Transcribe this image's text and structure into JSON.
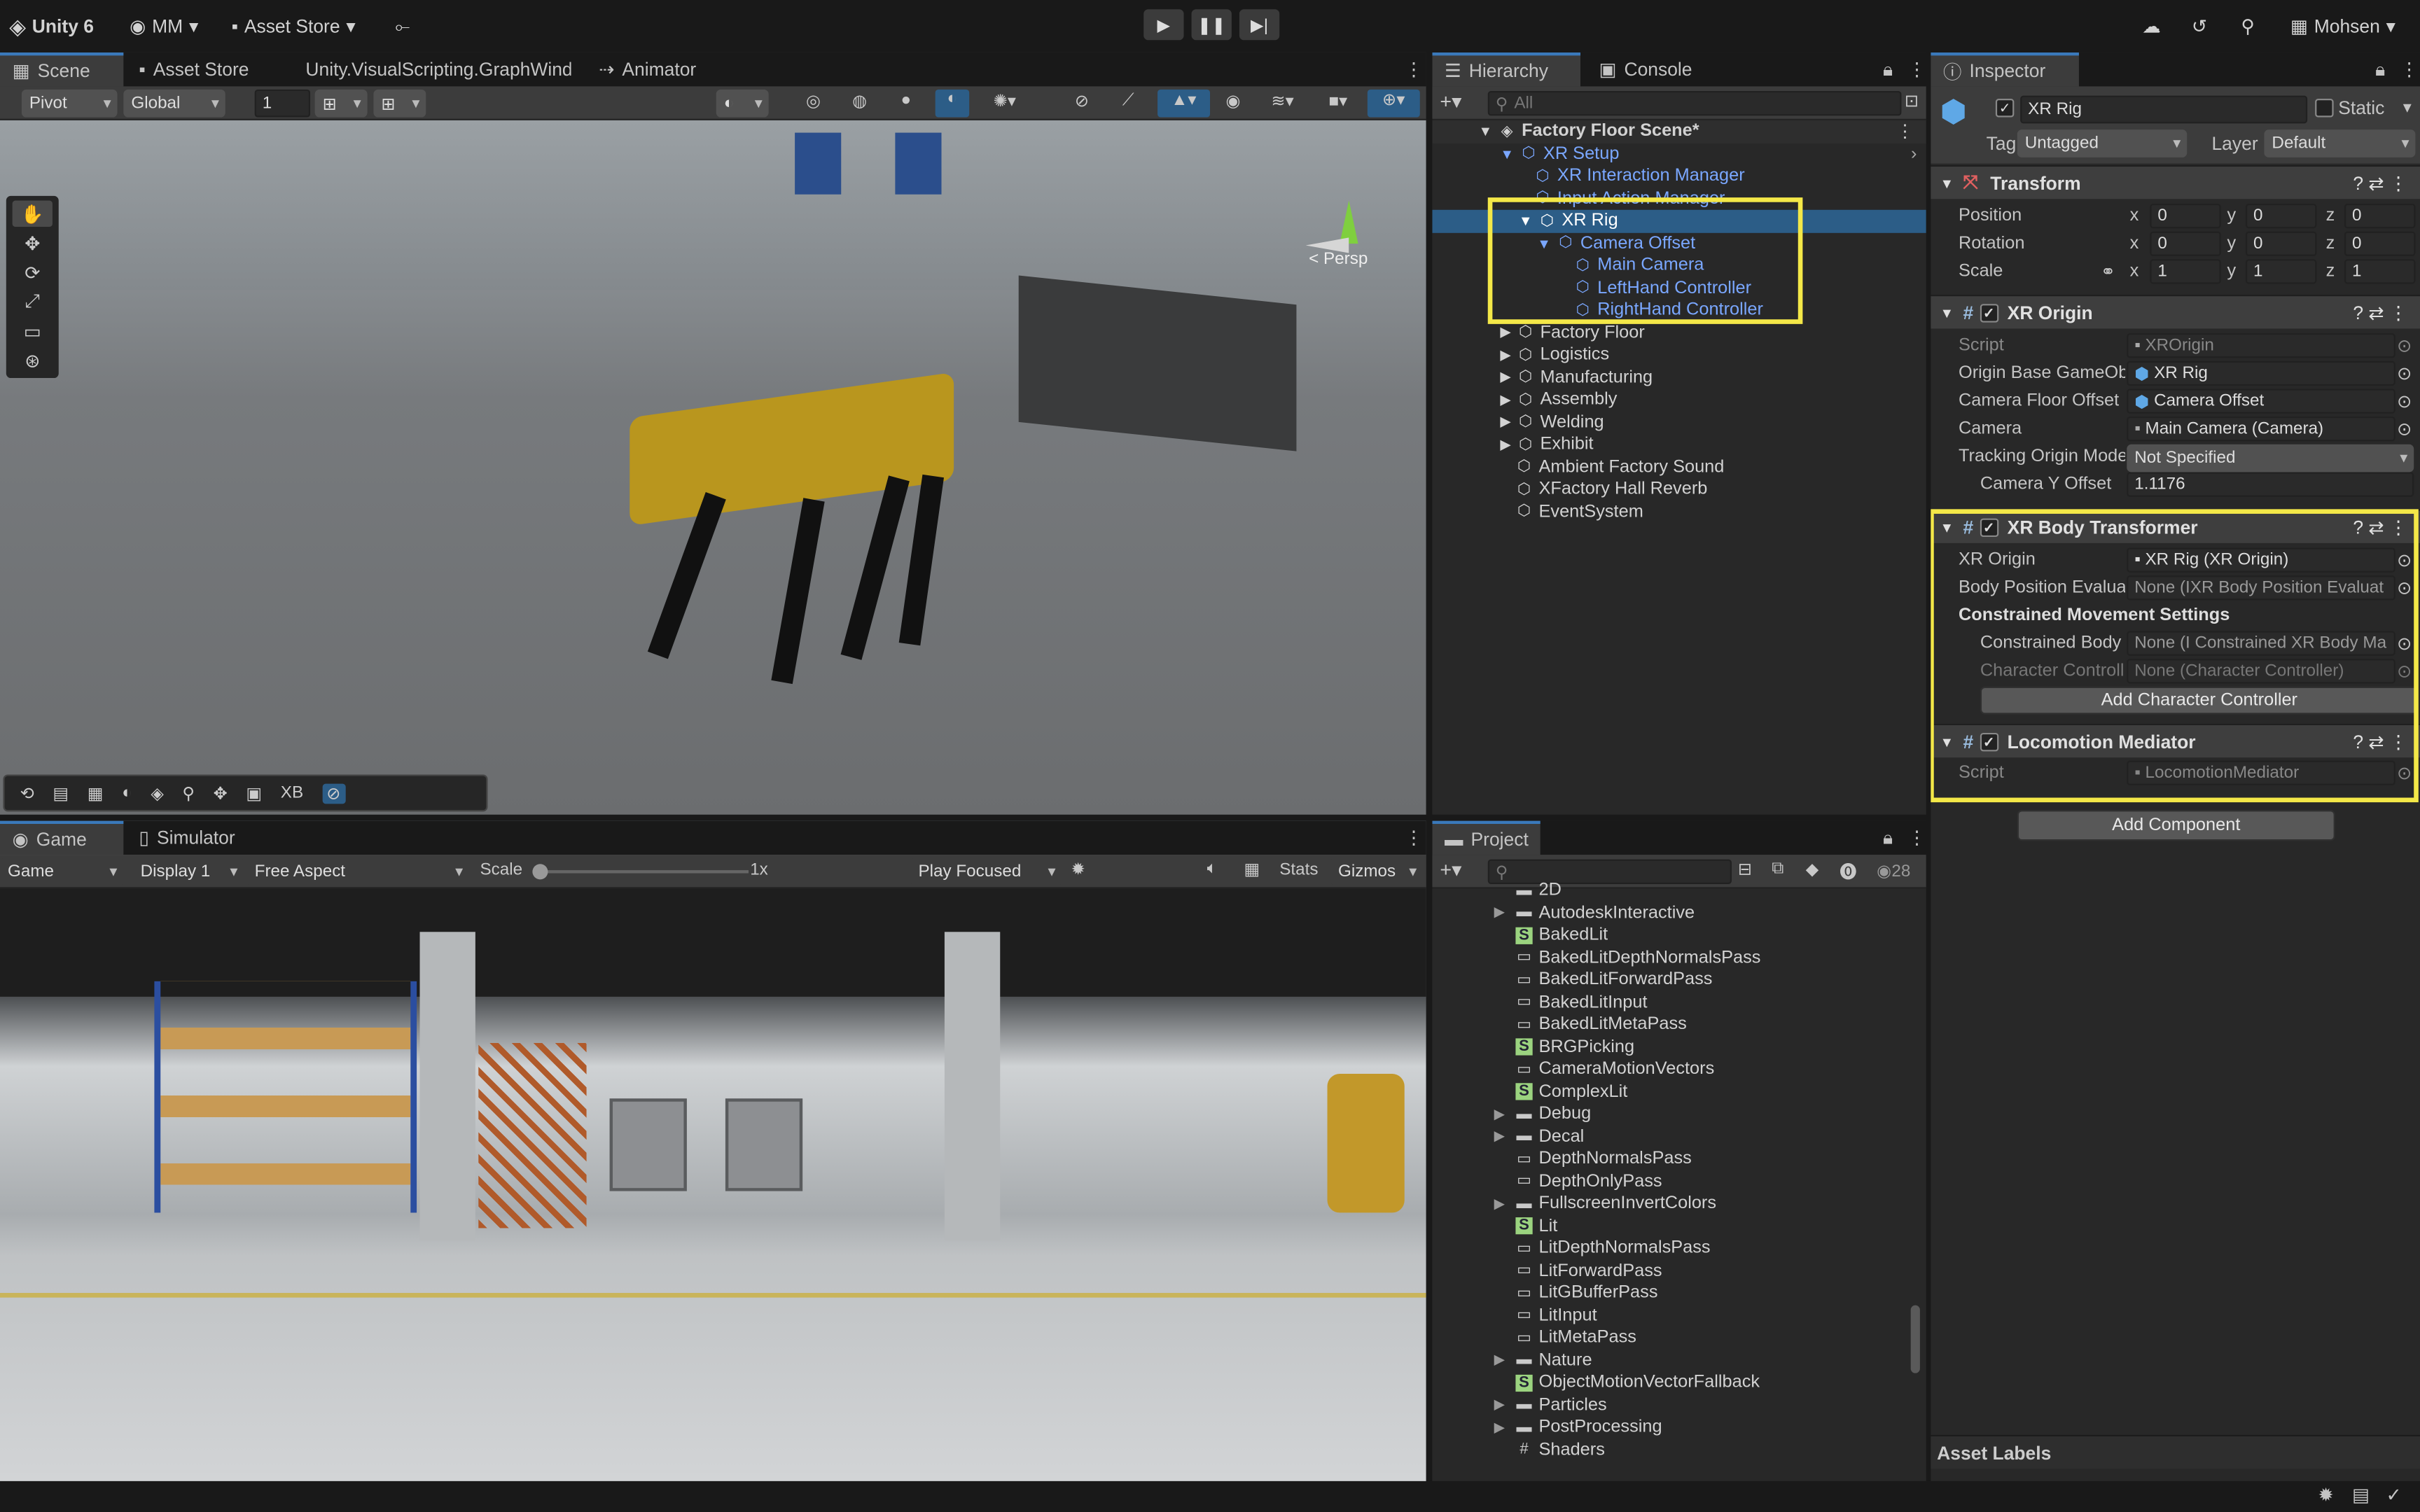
{
  "app": {
    "title": "Unity 6",
    "account": "MM",
    "store": "Asset Store",
    "user": "Mohsen"
  },
  "scene_tabs": [
    "Scene",
    "Asset Store",
    "Unity.VisualScripting.GraphWindo",
    "Animator"
  ],
  "scene_toolbar": {
    "pivot": "Pivot",
    "global": "Global",
    "grid_value": "1"
  },
  "scene_view": {
    "persp_label": "< Persp",
    "bottom_overlay": [
      "XB"
    ]
  },
  "game_tabs": [
    "Game",
    "Simulator"
  ],
  "game_toolbar": {
    "mode": "Game",
    "display": "Display 1",
    "aspect": "Free Aspect",
    "scale_label": "Scale",
    "scale_value": "1x",
    "play_focus": "Play Focused",
    "stats": "Stats",
    "gizmos": "Gizmos"
  },
  "hierarchy": {
    "tabs": [
      "Hierarchy",
      "Console"
    ],
    "search_placeholder": "All",
    "items": [
      {
        "label": "Factory Floor Scene*",
        "indent": 0
      },
      {
        "label": "XR Setup",
        "indent": 1
      },
      {
        "label": "XR Interaction Manager",
        "indent": 2
      },
      {
        "label": "Input Action Manager",
        "indent": 2
      },
      {
        "label": "XR Rig",
        "indent": 2
      },
      {
        "label": "Camera Offset",
        "indent": 3
      },
      {
        "label": "Main Camera",
        "indent": 4
      },
      {
        "label": "LeftHand Controller",
        "indent": 4
      },
      {
        "label": "RightHand Controller",
        "indent": 4
      },
      {
        "label": "Factory Floor",
        "indent": 1
      },
      {
        "label": "Logistics",
        "indent": 1
      },
      {
        "label": "Manufacturing",
        "indent": 1
      },
      {
        "label": "Assembly",
        "indent": 1
      },
      {
        "label": "Welding",
        "indent": 1
      },
      {
        "label": "Exhibit",
        "indent": 1
      },
      {
        "label": "Ambient Factory Sound",
        "indent": 1
      },
      {
        "label": "XFactory Hall Reverb",
        "indent": 1
      },
      {
        "label": "EventSystem",
        "indent": 1
      }
    ]
  },
  "project": {
    "tab": "Project",
    "count": "28",
    "items": [
      "2D",
      "AutodeskInteractive",
      "BakedLit",
      "BakedLitDepthNormalsPass",
      "BakedLitForwardPass",
      "BakedLitInput",
      "BakedLitMetaPass",
      "BRGPicking",
      "CameraMotionVectors",
      "ComplexLit",
      "Debug",
      "Decal",
      "DepthNormalsPass",
      "DepthOnlyPass",
      "FullscreenInvertColors",
      "Lit",
      "LitDepthNormalsPass",
      "LitForwardPass",
      "LitGBufferPass",
      "LitInput",
      "LitMetaPass",
      "Nature",
      "ObjectMotionVectorFallback",
      "Particles",
      "PostProcessing",
      "Shaders"
    ]
  },
  "inspector": {
    "tab": "Inspector",
    "object_name": "XR Rig",
    "static_label": "Static",
    "tag_label": "Tag",
    "tag_value": "Untagged",
    "layer_label": "Layer",
    "layer_value": "Default",
    "transform": {
      "title": "Transform",
      "position": "Position",
      "rotation": "Rotation",
      "scale": "Scale",
      "pos": [
        "0",
        "0",
        "0"
      ],
      "rot": [
        "0",
        "0",
        "0"
      ],
      "scl": [
        "1",
        "1",
        "1"
      ]
    },
    "xr_origin": {
      "title": "XR Origin",
      "rows": [
        {
          "label": "Script",
          "value": "XROrigin"
        },
        {
          "label": "Origin Base GameOb",
          "value": "XR Rig"
        },
        {
          "label": "Camera Floor Offset",
          "value": "Camera Offset"
        },
        {
          "label": "Camera",
          "value": "Main Camera (Camera)"
        },
        {
          "label": "Tracking Origin Mode",
          "value": "Not Specified"
        },
        {
          "label": "Camera Y Offset",
          "value": "1.1176"
        }
      ]
    },
    "xr_body": {
      "title": "XR Body Transformer",
      "rows": [
        {
          "label": "XR Origin",
          "value": "XR Rig (XR Origin)"
        },
        {
          "label": "Body Position Evalua",
          "value": "None (IXR Body Position Evaluat"
        }
      ],
      "section": "Constrained Movement Settings",
      "rows2": [
        {
          "label": "Constrained Body",
          "value": "None (I Constrained XR Body Ma"
        },
        {
          "label": "Character Controll",
          "value": "None (Character Controller)"
        }
      ],
      "button": "Add Character Controller"
    },
    "locomotion": {
      "title": "Locomotion Mediator",
      "script_label": "Script",
      "script_value": "LocomotionMediator"
    },
    "add_component": "Add Component",
    "asset_labels": "Asset Labels"
  },
  "axis_labels": {
    "x": "x",
    "y": "y",
    "z": "z"
  }
}
